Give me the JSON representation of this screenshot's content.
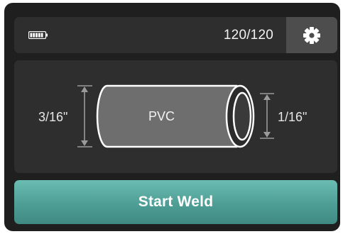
{
  "status_bar": {
    "battery_icon": "battery-full-icon",
    "counter": "120/120",
    "settings_icon": "gear-icon"
  },
  "pipe": {
    "material": "PVC",
    "outer_dimension": "3/16\"",
    "wall_dimension": "1/16\""
  },
  "actions": {
    "start_label": "Start Weld"
  },
  "colors": {
    "screen_bg": "#1f1f1f",
    "panel_bg": "#2e2e2e",
    "settings_bg": "#4d4d4d",
    "accent": "#4e9e95",
    "pipe_fill": "#6e6e6e",
    "outline": "#ffffff"
  }
}
